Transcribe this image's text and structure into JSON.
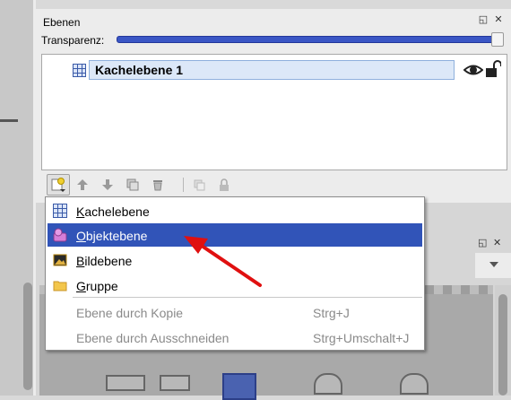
{
  "layers_panel": {
    "title": "Ebenen",
    "opacity_label": "Transparenz:",
    "opacity_value": 1.0,
    "layers": [
      {
        "name": "Kachelebene 1",
        "visible": true,
        "locked": false
      }
    ]
  },
  "layer_menu": {
    "items": [
      {
        "label": "Kachelebene",
        "icon": "tile-layer-icon",
        "selected": false,
        "enabled": true
      },
      {
        "label": "Objektebene",
        "icon": "object-layer-icon",
        "selected": true,
        "enabled": true
      },
      {
        "label": "Bildebene",
        "icon": "image-layer-icon",
        "selected": false,
        "enabled": true
      },
      {
        "label": "Gruppe",
        "icon": "folder-icon",
        "selected": false,
        "enabled": true
      }
    ],
    "disabled_items": [
      {
        "label": "Ebene durch Kopie",
        "shortcut": "Strg+J"
      },
      {
        "label": "Ebene durch Ausschneiden",
        "shortcut": "Strg+Umschalt+J"
      }
    ]
  },
  "colors": {
    "selection": "#3154b8",
    "slider": "#3a56c5",
    "annotation_arrow": "#e01010"
  }
}
